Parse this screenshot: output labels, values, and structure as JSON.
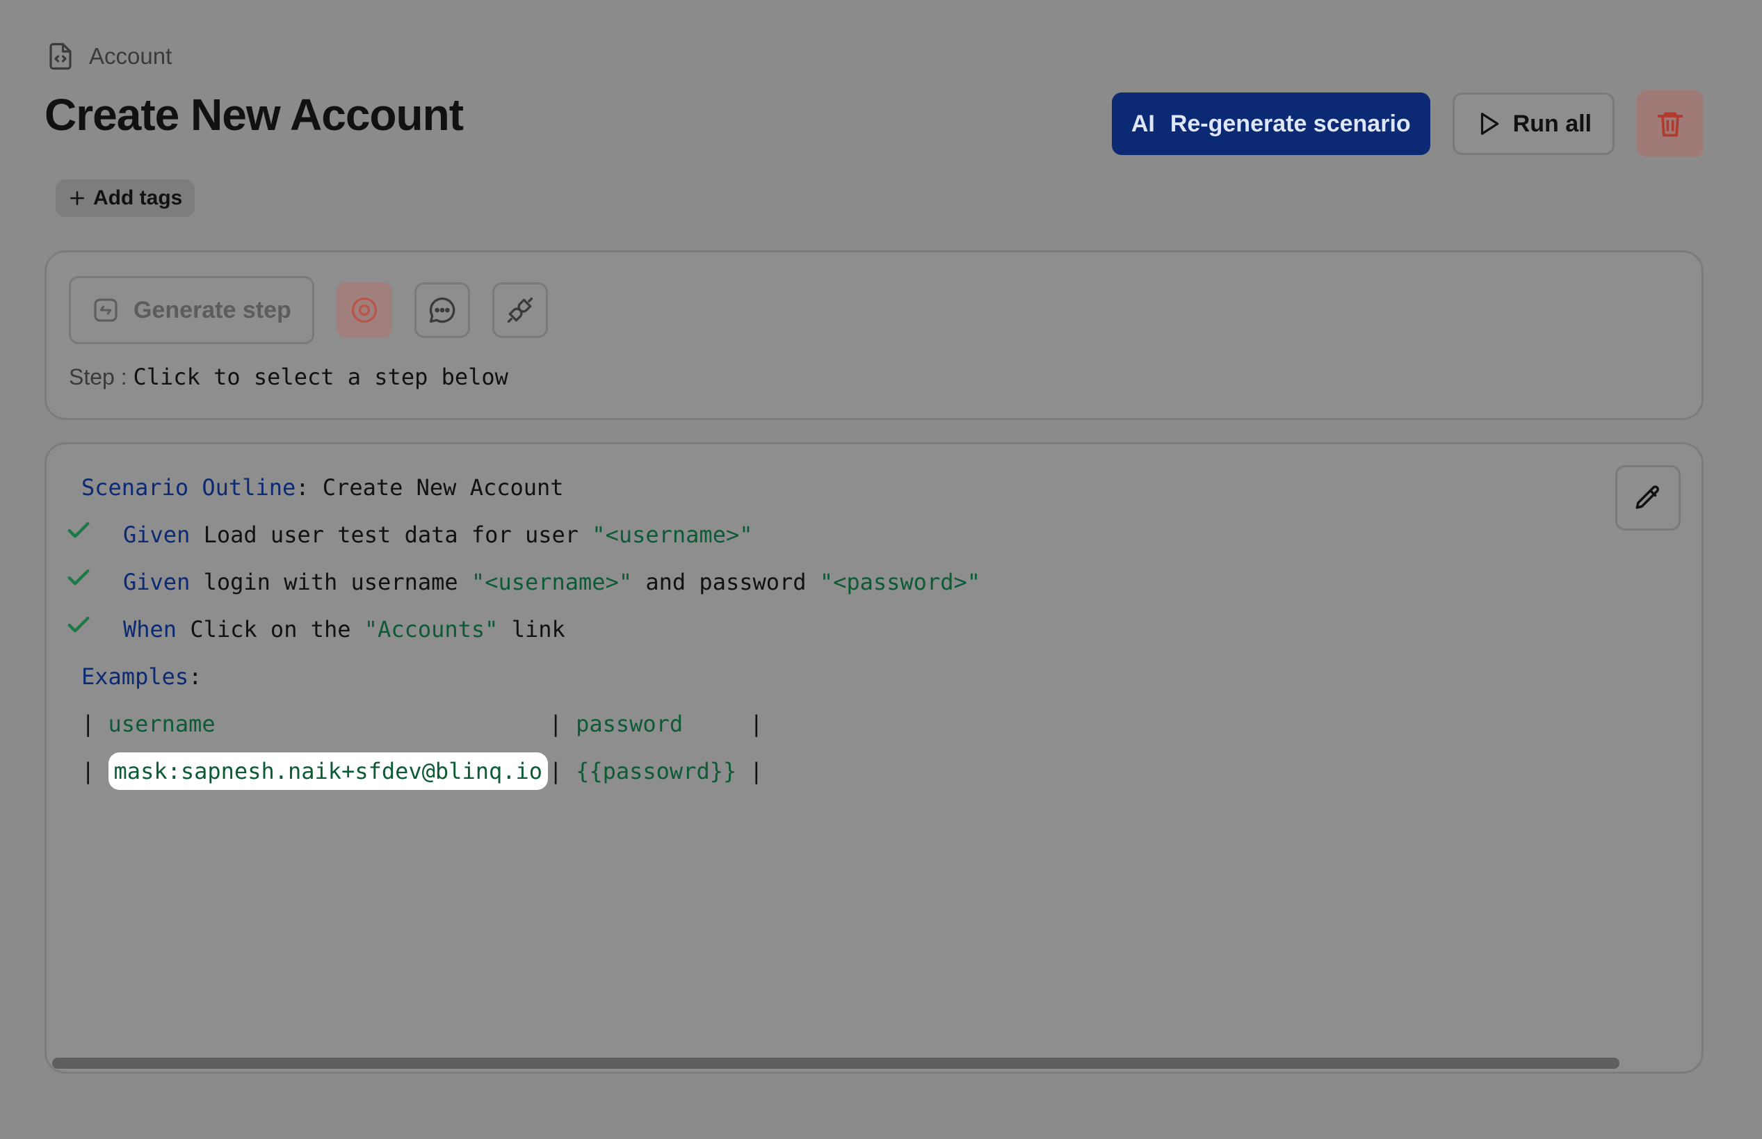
{
  "breadcrumb": {
    "label": "Account",
    "icon": "file-code-icon"
  },
  "page_title": "Create New Account",
  "actions": {
    "regen_prefix": "AI",
    "regen_label": "Re-generate scenario",
    "run_label": "Run all"
  },
  "tags": {
    "add_label": "Add tags"
  },
  "step_panel": {
    "generate_label": "Generate step",
    "step_prefix": "Step :",
    "step_hint": "Click to select a step below"
  },
  "scenario": {
    "outline_keyword": "Scenario Outline",
    "outline_colon": ":",
    "outline_name": " Create New Account",
    "steps": [
      {
        "keyword": "Given",
        "text_a": " Load user test data for user ",
        "str_a": "\"<username>\"",
        "text_b": "",
        "str_b": ""
      },
      {
        "keyword": "Given",
        "text_a": " login with username ",
        "str_a": "\"<username>\"",
        "text_b": " and password ",
        "str_b": "\"<password>\""
      },
      {
        "keyword": "When",
        "text_a": " Click on the ",
        "str_a": "\"Accounts\"",
        "text_b": " link",
        "str_b": ""
      }
    ],
    "examples_keyword": "Examples",
    "examples_colon": ":",
    "table": {
      "header": [
        "username",
        "password"
      ],
      "row": [
        "mask:sapnesh.naik+sfdev@blinq.io",
        "{{passowrd}}"
      ]
    }
  },
  "colors": {
    "primary": "#0b2a73",
    "string": "#0d5a36",
    "danger": "#c0392b",
    "overlay_bg": "#8b8b8b"
  }
}
